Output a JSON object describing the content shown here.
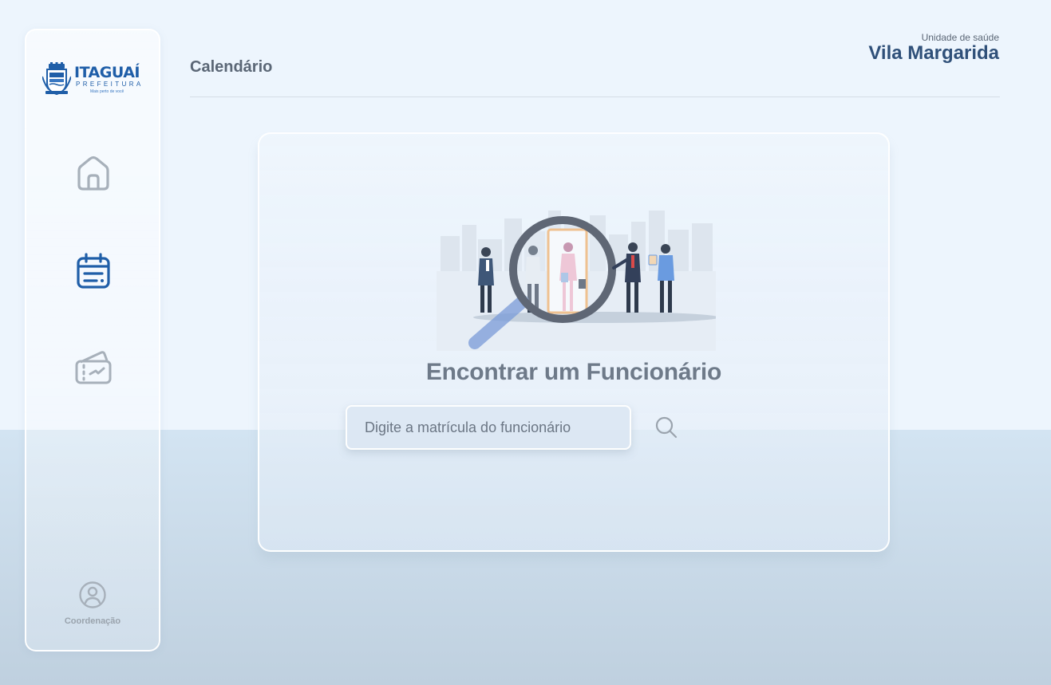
{
  "brand": {
    "name": "ITAGUAÍ",
    "subtitle": "PREFEITURA",
    "tagline": "Mais perto de você"
  },
  "sidebar": {
    "items": [
      {
        "id": "home",
        "icon": "home-icon",
        "active": false
      },
      {
        "id": "calendar",
        "icon": "calendar-icon",
        "active": true
      },
      {
        "id": "tickets",
        "icon": "ticket-icon",
        "active": false
      }
    ],
    "profile": {
      "icon": "user-circle-icon",
      "label": "Coordenação"
    }
  },
  "header": {
    "title": "Calendário",
    "unit_label": "Unidade de saúde",
    "unit_name": "Vila Margarida"
  },
  "main": {
    "heading": "Encontrar um Funcionário",
    "search": {
      "placeholder": "Digite a matrícula do funcionário",
      "value": "",
      "button_icon": "search-icon"
    }
  },
  "colors": {
    "accent": "#1f5ea8",
    "icon_inactive": "#a7b0ba",
    "heading": "#6e7a89",
    "unit_name": "#2f5079",
    "background": "#edf5fd"
  }
}
